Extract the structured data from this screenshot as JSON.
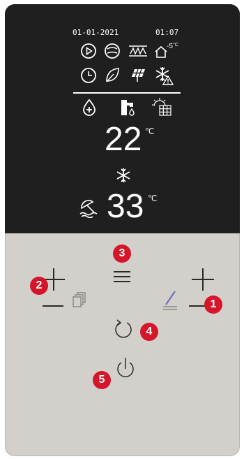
{
  "status": {
    "date": "01-01-2021",
    "time": "01:07"
  },
  "outdoor": {
    "temp": "-5",
    "unit": "°C"
  },
  "setpoints": {
    "heating": {
      "value": "22",
      "unit": "℃"
    },
    "cooling": {
      "value": "33",
      "unit": "℃"
    }
  },
  "callouts": [
    "1",
    "2",
    "3",
    "4",
    "5"
  ],
  "colors": {
    "screen_bg": "#1f1f1f",
    "panel_bg": "#d3cfcb",
    "badge": "#d4152a",
    "pen_accent": "#6a6ac0"
  },
  "icons": {
    "row1": [
      "play-circle-icon",
      "pump-icon",
      "heating-element-icon",
      "house-outdoor-icon"
    ],
    "row2": [
      "clock-icon",
      "leaf-icon",
      "solar-panel-icon",
      "snowflake-warning-icon"
    ],
    "row3": [
      "water-drop-plus-icon",
      "tap-water-icon",
      "solar-grid-icon"
    ]
  }
}
